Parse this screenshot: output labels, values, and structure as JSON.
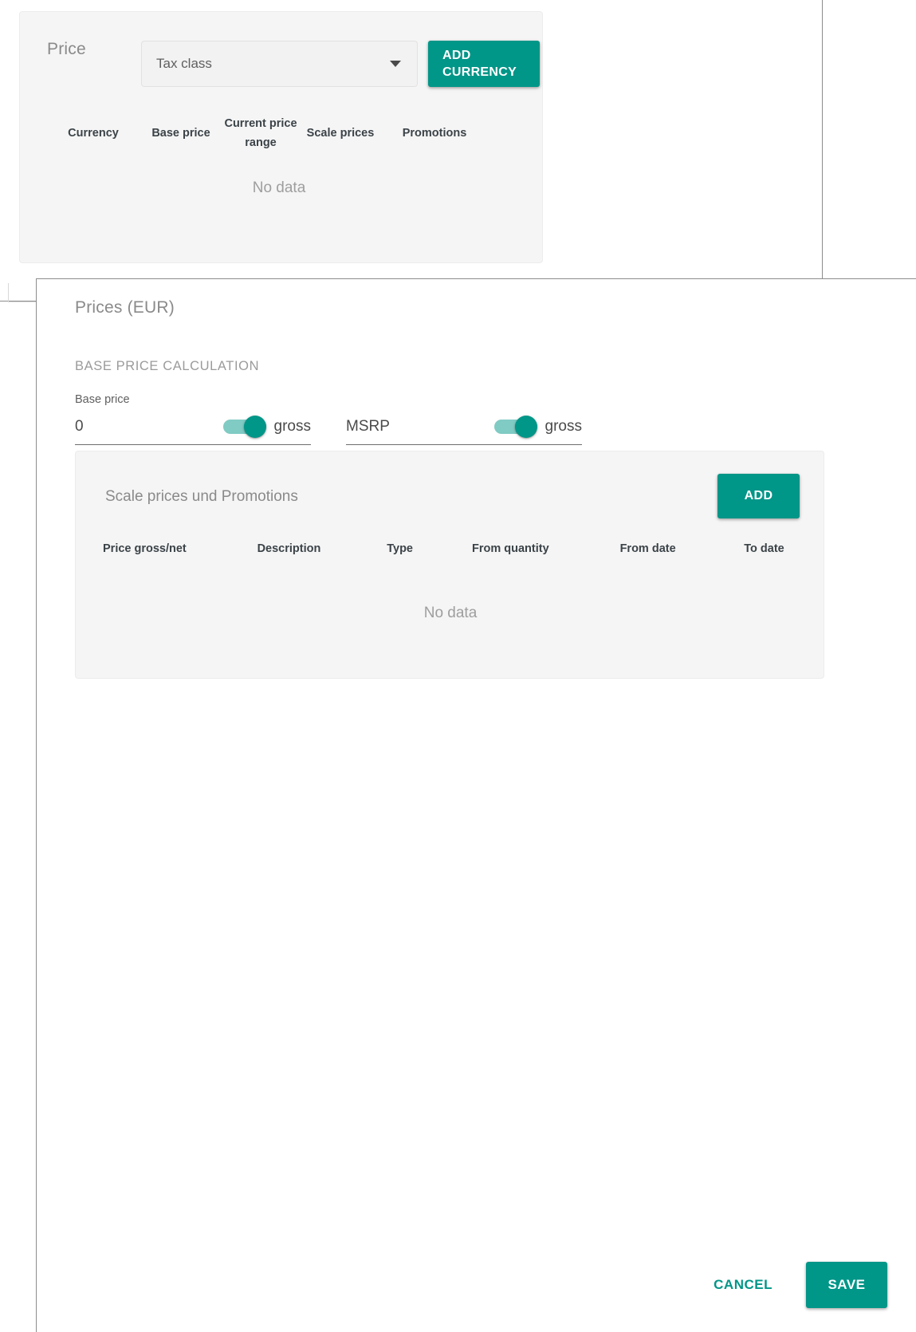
{
  "background": {
    "price_label": "Price",
    "tax_class_select": {
      "value": "Tax class",
      "caret_icon": "chevron-down-icon"
    },
    "add_currency_label": "ADD CURRENCY",
    "table": {
      "columns": [
        "Currency",
        "Base price",
        "Current price range",
        "Scale prices",
        "Promotions"
      ],
      "empty_text": "No data"
    }
  },
  "dialog": {
    "title": "Prices (EUR)",
    "section_heading": "BASE PRICE CALCULATION",
    "base_price_field_label": "Base price",
    "fields": [
      {
        "name": "base-price",
        "value": "0",
        "toggle_on": true,
        "toggle_caption": "gross"
      },
      {
        "name": "msrp",
        "value": "MSRP",
        "toggle_on": true,
        "toggle_caption": "gross"
      }
    ],
    "scale_card": {
      "title": "Scale prices und Promotions",
      "add_label": "ADD",
      "columns": [
        "Price gross/net",
        "Description",
        "Type",
        "From quantity",
        "From date",
        "To date"
      ],
      "empty_text": "No data"
    },
    "footer": {
      "cancel_label": "CANCEL",
      "save_label": "SAVE"
    }
  },
  "colors": {
    "accent": "#009688",
    "toggle_track": "#80cbc4",
    "panel_bg": "#f5f5f5",
    "muted_text": "#9e9e9e"
  }
}
